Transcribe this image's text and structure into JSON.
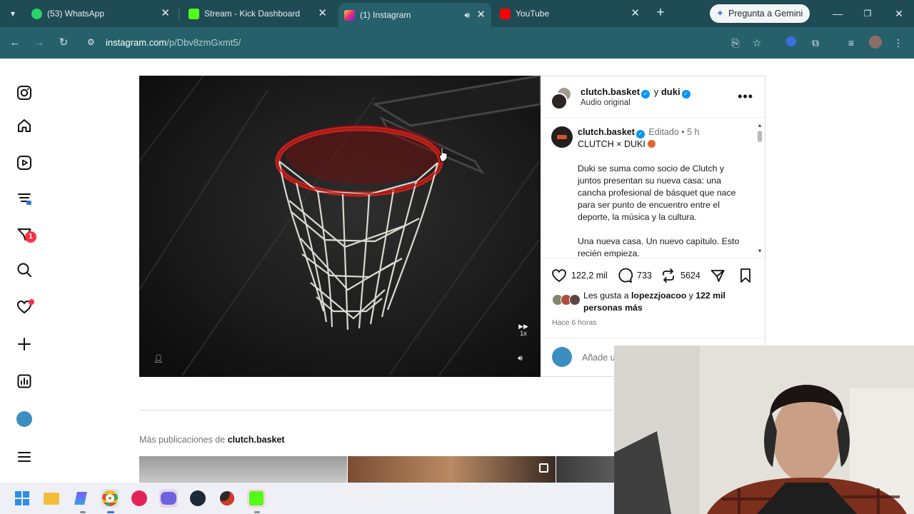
{
  "browser": {
    "tabs": [
      {
        "title": "(53) WhatsApp",
        "favicon": "whatsapp-icon",
        "color": "#25d366",
        "active": false
      },
      {
        "title": "Stream - Kick Dashboard",
        "favicon": "kick-icon",
        "color": "#53fc18",
        "active": false
      },
      {
        "title": "(1) Instagram",
        "favicon": "instagram-icon",
        "color": "#e1306c",
        "active": true
      },
      {
        "title": "YouTube",
        "favicon": "youtube-icon",
        "color": "#ff0000",
        "active": false
      }
    ],
    "gemini_label": "Pregunta a Gemini",
    "url_host": "instagram.com",
    "url_path": "/p/Dbv8zmGxmt5/"
  },
  "post": {
    "header": {
      "username": "clutch.basket",
      "connector": "y",
      "collaborator": "duki",
      "audio": "Audio original"
    },
    "caption": {
      "username": "clutch.basket",
      "edited": "Editado",
      "time": "5 h",
      "title": "CLUTCH × DUKI",
      "paragraph1": "Duki se suma como socio de Clutch y juntos presentan su nueva casa: una cancha profesional de básquet que nace para ser punto de encuentro entre el deporte, la música y la cultura.",
      "paragraph2": "Una nueva casa. Un nuevo capítulo. Esto recién empieza."
    },
    "stats": {
      "likes": "122,2 mil",
      "comments": "733",
      "reposts": "5624"
    },
    "likers": {
      "prefix": "Les gusta a",
      "user": "lopezzjoacoo",
      "middle": "y",
      "count": "122 mil personas más"
    },
    "time_ago": "Hace 6 horas",
    "comment_placeholder": "Añade u",
    "speed_label": "1x"
  },
  "more_posts": {
    "prefix": "Más publicaciones de",
    "user": "clutch.basket"
  },
  "sidebar": {
    "notification_count": "1"
  },
  "colors": {
    "chrome_tabstrip": "#1f4b55",
    "chrome_toolbar": "#26616b",
    "instagram_red": "#ff3040",
    "verified_blue": "#0095f6"
  }
}
